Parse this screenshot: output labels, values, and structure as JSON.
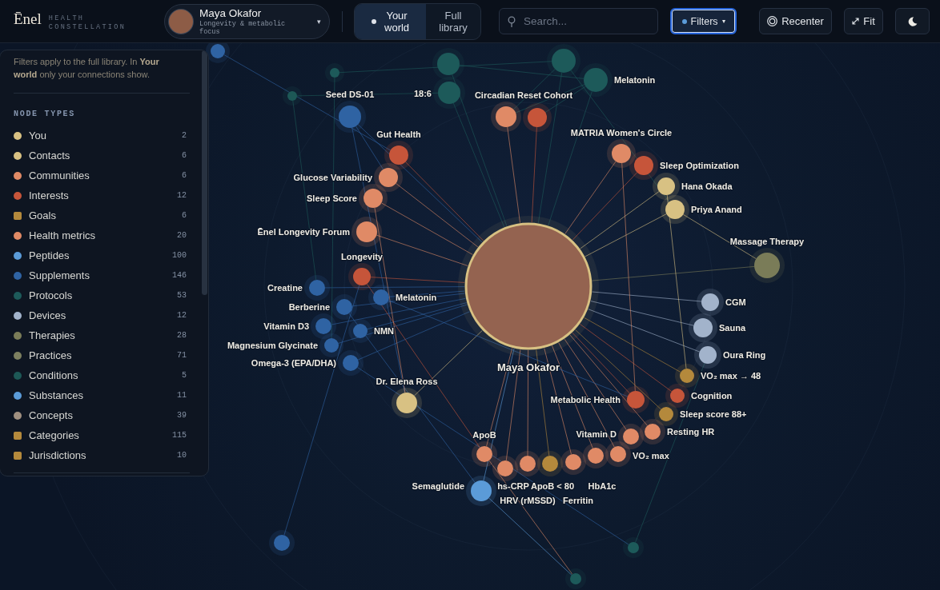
{
  "header": {
    "logo": "Ēnel",
    "tagline": "HEALTH CONSTELLATION",
    "profile": {
      "name": "Maya Okafor",
      "subtitle": "Longevity & metabolic focus",
      "caret": "▾"
    },
    "view_toggle": [
      {
        "label": "Your world",
        "selected": true
      },
      {
        "label": "Full library",
        "selected": false
      }
    ],
    "search": {
      "placeholder": "Search..."
    },
    "filters_button": {
      "label": "Filters",
      "caret": "▾",
      "expanded": true
    },
    "buttons": [
      {
        "kind": "recenter",
        "label": "Recenter"
      },
      {
        "kind": "fit",
        "label": "Fit"
      },
      {
        "kind": "theme"
      }
    ]
  },
  "filter_panel": {
    "note": "Filters apply to the full library. In **Your world** only your connections show.",
    "heading": "NODE TYPES",
    "items": [
      {
        "label": "You",
        "count": "2",
        "color": "#d8c183",
        "kind": "circle"
      },
      {
        "label": "Contacts",
        "count": "6",
        "color": "#d8c183",
        "kind": "circle"
      },
      {
        "label": "Communities",
        "count": "6",
        "color": "#e08a66",
        "kind": "circle"
      },
      {
        "label": "Interests",
        "count": "12",
        "color": "#c6553a",
        "kind": "circle"
      },
      {
        "label": "Goals",
        "count": "6",
        "color": "#b4893c",
        "kind": "square"
      },
      {
        "label": "Health metrics",
        "count": "20",
        "color": "#e08a66",
        "kind": "circle"
      },
      {
        "label": "Peptides",
        "count": "100",
        "color": "#5b9bd8",
        "kind": "circle"
      },
      {
        "label": "Supplements",
        "count": "146",
        "color": "#2f63a3",
        "kind": "circle"
      },
      {
        "label": "Protocols",
        "count": "53",
        "color": "#1d5a5a",
        "kind": "circle"
      },
      {
        "label": "Devices",
        "count": "12",
        "color": "#a2b3cb",
        "kind": "circle"
      },
      {
        "label": "Therapies",
        "count": "28",
        "color": "#7a7c58",
        "kind": "circle"
      },
      {
        "label": "Practices",
        "count": "71",
        "color": "#7d8060",
        "kind": "circle"
      },
      {
        "label": "Conditions",
        "count": "5",
        "color": "#1d5856",
        "kind": "circle"
      },
      {
        "label": "Substances",
        "count": "11",
        "color": "#5b9bd8",
        "kind": "circle"
      },
      {
        "label": "Concepts",
        "count": "39",
        "color": "#a09080",
        "kind": "circle"
      },
      {
        "label": "Categories",
        "count": "115",
        "color": "#b4893c",
        "kind": "square"
      },
      {
        "label": "Jurisdictions",
        "count": "10",
        "color": "#b4893c",
        "kind": "square"
      }
    ]
  },
  "graph": {
    "center": {
      "label": "Maya Okafor"
    },
    "nodes": [
      {
        "kind": "supplement"
      },
      {
        "kind": "protocol"
      },
      {
        "kind": "protocol"
      },
      {
        "kind": "protocol"
      },
      {
        "kind": "protocol",
        "label": "Melatonin"
      },
      {
        "kind": "condition"
      },
      {
        "kind": "supplement",
        "label": "Seed DS-01"
      },
      {
        "kind": "protocol",
        "label": "18:6"
      },
      {
        "kind": "community",
        "label": "Circadian Reset Cohort"
      },
      {
        "kind": "interest"
      },
      {
        "kind": "interest",
        "label": "Gut Health"
      },
      {
        "kind": "community",
        "label": "MATRIA Women's Circle"
      },
      {
        "kind": "interest",
        "label": "Sleep Optimization"
      },
      {
        "kind": "metric",
        "label": "Glucose Variability"
      },
      {
        "kind": "contact",
        "label": "Hana Okada"
      },
      {
        "kind": "metric",
        "label": "Sleep Score"
      },
      {
        "kind": "contact",
        "label": "Priya Anand"
      },
      {
        "kind": "community",
        "label": "Ēnel Longevity Forum"
      },
      {
        "kind": "therapy",
        "label": "Massage Therapy"
      },
      {
        "kind": "interest",
        "label": "Longevity"
      },
      {
        "kind": "supplement",
        "label": "Creatine"
      },
      {
        "kind": "supplement",
        "label": "Melatonin"
      },
      {
        "kind": "supplement",
        "label": "Berberine"
      },
      {
        "kind": "device",
        "label": "CGM"
      },
      {
        "kind": "supplement",
        "label": "Vitamin D3"
      },
      {
        "kind": "supplement",
        "label": "NMN"
      },
      {
        "kind": "device",
        "label": "Sauna"
      },
      {
        "kind": "supplement",
        "label": "Magnesium Glycinate"
      },
      {
        "kind": "device",
        "label": "Oura Ring"
      },
      {
        "kind": "supplement",
        "label": "Omega-3 (EPA/DHA)"
      },
      {
        "kind": "contact",
        "label": "Dr. Elena Ross"
      },
      {
        "kind": "goal",
        "label": "VO₂ max → 48"
      },
      {
        "kind": "interest",
        "label": "Metabolic Health"
      },
      {
        "kind": "interest",
        "label": "Cognition"
      },
      {
        "kind": "goal",
        "label": "Sleep score 88+"
      },
      {
        "kind": "metric",
        "label": "ApoB"
      },
      {
        "kind": "metric",
        "label": "Vitamin D"
      },
      {
        "kind": "metric",
        "label": "Resting HR"
      },
      {
        "kind": "metric",
        "label": "VO₂ max"
      },
      {
        "kind": "peptide",
        "label": "Semaglutide"
      },
      {
        "kind": "metric",
        "label": "hs-CRP"
      },
      {
        "kind": "goal",
        "label": "ApoB < 80"
      },
      {
        "kind": "metric",
        "label": "HbA1c"
      },
      {
        "kind": "metric",
        "label": "HRV (rMSSD)"
      },
      {
        "kind": "metric",
        "label": "Ferritin"
      },
      {
        "kind": "supplement"
      },
      {
        "kind": "protocol"
      },
      {
        "kind": "protocol"
      }
    ]
  }
}
